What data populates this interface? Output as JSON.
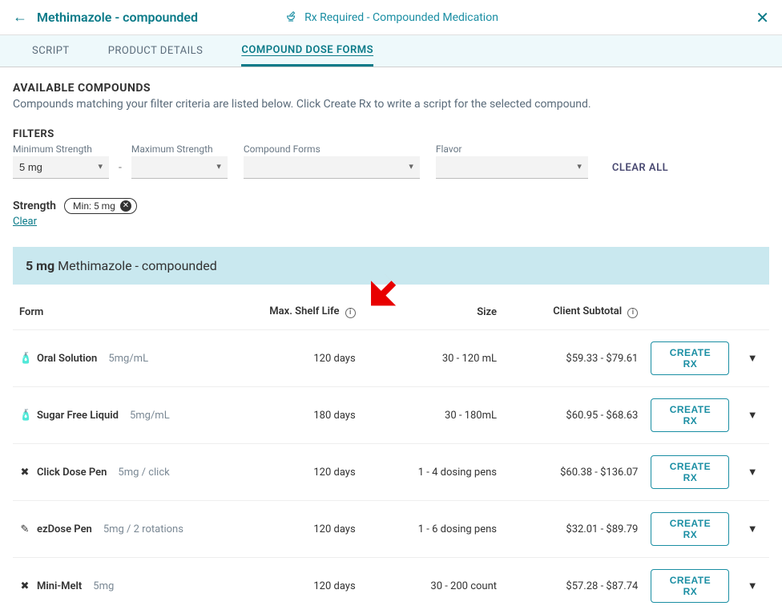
{
  "header": {
    "title": "Methimazole - compounded",
    "center_label": "Rx Required - Compounded Medication"
  },
  "tabs": [
    {
      "label": "SCRIPT",
      "active": false
    },
    {
      "label": "PRODUCT DETAILS",
      "active": false
    },
    {
      "label": "COMPOUND DOSE FORMS",
      "active": true
    }
  ],
  "available": {
    "title": "AVAILABLE COMPOUNDS",
    "subtitle": "Compounds matching your filter criteria are listed below. Click Create Rx to write a script for the selected compound."
  },
  "filters": {
    "title": "FILTERS",
    "min_strength": {
      "label": "Minimum Strength",
      "value": "5 mg"
    },
    "max_strength": {
      "label": "Maximum Strength",
      "value": ""
    },
    "compound_forms": {
      "label": "Compound Forms",
      "value": ""
    },
    "flavor": {
      "label": "Flavor",
      "value": ""
    },
    "clear_all_label": "CLEAR ALL"
  },
  "chips": {
    "strength_label": "Strength",
    "chip_text": "Min: 5 mg",
    "clear_label": "Clear"
  },
  "compound": {
    "strength": "5 mg",
    "name": "Methimazole - compounded"
  },
  "table": {
    "headers": {
      "form": "Form",
      "shelf": "Max. Shelf Life",
      "size": "Size",
      "subtotal": "Client Subtotal"
    },
    "create_rx_label": "CREATE RX",
    "rows": [
      {
        "icon": "🧴",
        "form": "Oral Solution",
        "dose": "5mg/mL",
        "shelf": "120 days",
        "size": "30 - 120 mL",
        "subtotal": "$59.33 - $79.61"
      },
      {
        "icon": "🧴",
        "form": "Sugar Free Liquid",
        "dose": "5mg/mL",
        "shelf": "180 days",
        "size": "30 - 180mL",
        "subtotal": "$60.95 - $68.63"
      },
      {
        "icon": "✖",
        "form": "Click Dose Pen",
        "dose": "5mg / click",
        "shelf": "120 days",
        "size": "1 - 4 dosing pens",
        "subtotal": "$60.38 - $136.07"
      },
      {
        "icon": "✎",
        "form": "ezDose Pen",
        "dose": "5mg / 2 rotations",
        "shelf": "120 days",
        "size": "1 - 6 dosing pens",
        "subtotal": "$32.01 - $89.79"
      },
      {
        "icon": "✖",
        "form": "Mini-Melt",
        "dose": "5mg",
        "shelf": "120 days",
        "size": "30 - 200 count",
        "subtotal": "$57.28 - $87.74"
      }
    ]
  }
}
